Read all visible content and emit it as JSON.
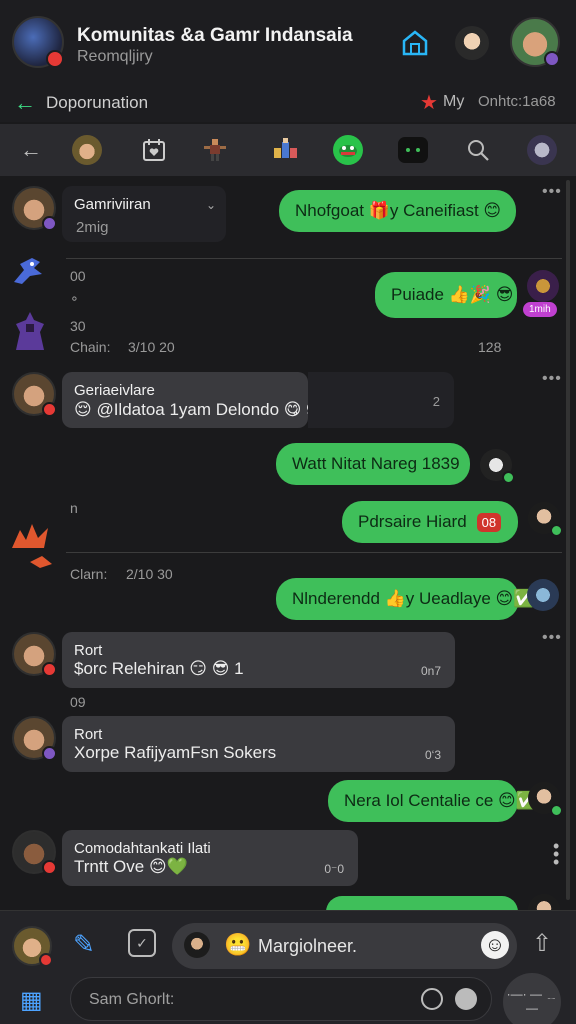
{
  "header": {
    "title": "Komunitas &a Gamr Indansaia",
    "subtitle": "Reomqljiry"
  },
  "subbar": {
    "back_icon": "arrow-left-icon",
    "label": "Doporunation",
    "star_icon": "star-icon",
    "my_label": "My",
    "online_label": "Onhtc:1a68"
  },
  "toolbar": {
    "items": [
      "back-icon",
      "avatar",
      "calendar-heart-icon",
      "character-sprite",
      "party-sprite",
      "green-game-icon",
      "dark-controller-icon",
      "search-icon",
      "avatar"
    ]
  },
  "messages": {
    "m1": {
      "name": "Gamriviiran",
      "sub": "2mig",
      "dropdown_icon": "chevron-down-icon"
    },
    "o1": {
      "text": "Nhofgoat 🎁y Caneifiast 😊"
    },
    "meta1": {
      "a": "00",
      "b": "∘"
    },
    "o2": {
      "text": "Puiade 👍🎉 😎",
      "badge": "1mih"
    },
    "meta2": {
      "a": "30",
      "chain": "Chain:",
      "date": "3/10 20",
      "count": "128"
    },
    "m2": {
      "name": "Geriaeivlare",
      "text": "😌 @Ildatoa 1yam Delondo 😋 9",
      "count": "2"
    },
    "o3": {
      "text": "Watt Nitat Nareg 1839"
    },
    "meta3": {
      "a": "n"
    },
    "o4": {
      "text": "Pdrsaire Hiard",
      "tag": "08"
    },
    "meta4": {
      "chain": "Clarn:",
      "date": "2/10 30"
    },
    "o5": {
      "text": "Nlnderendd 👍y Ueadlaye 😊✅"
    },
    "m3": {
      "name": "Rort",
      "text": "$orc Relehiran 😏 😎 1",
      "time": "0n7"
    },
    "meta5": {
      "a": "09"
    },
    "m4": {
      "name": "Rort",
      "text": "Xorpe RafijyamFsn Sokers",
      "time": "0‘3"
    },
    "o6": {
      "text": "Nera Iol Centalie ce 😊✅"
    },
    "m5": {
      "name": "Comodahtankati Ilati",
      "text": "Trntt Ove 😊💚",
      "time": "0⁻0"
    }
  },
  "composer": {
    "emoji": "😬",
    "text": "Margiolneer.",
    "placeholder": "Sam Ghorlt:",
    "send_label": "·—· — ﹎—"
  },
  "colors": {
    "accent_green": "#3fbf5a",
    "accent_blue": "#4da3ff",
    "badge_red": "#e53935"
  }
}
